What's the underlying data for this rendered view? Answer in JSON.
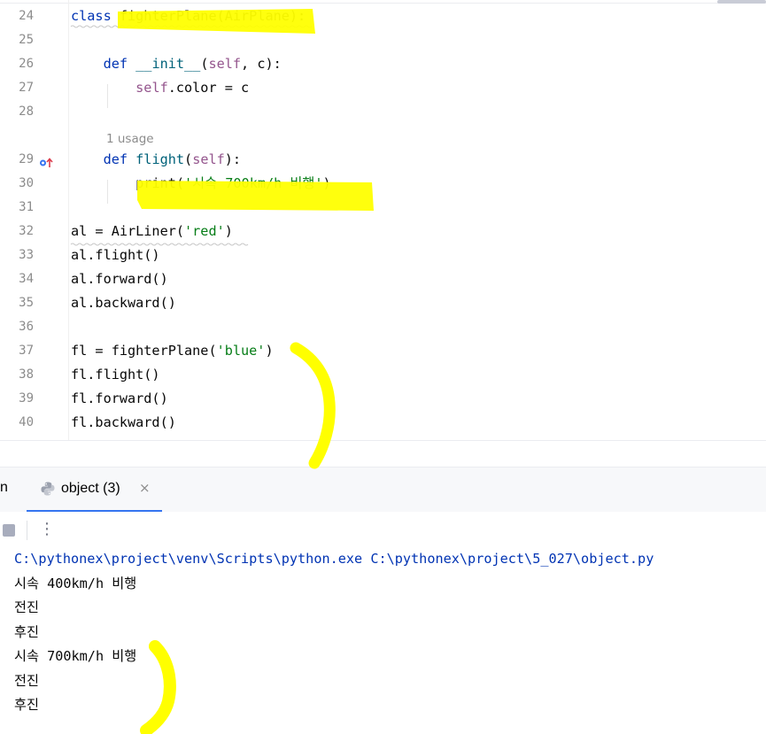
{
  "editor": {
    "inlay_hint": "1 usage",
    "lines": [
      {
        "no": "24",
        "tokens": [
          {
            "t": "class ",
            "c": "kw"
          },
          {
            "t": "fighterPlane",
            "c": ""
          },
          {
            "t": "(AirPlane):",
            "c": ""
          }
        ]
      },
      {
        "no": "25",
        "tokens": []
      },
      {
        "no": "26",
        "tokens": [
          {
            "t": "    ",
            "c": ""
          },
          {
            "t": "def ",
            "c": "kw"
          },
          {
            "t": "__init__",
            "c": "fn"
          },
          {
            "t": "(",
            "c": ""
          },
          {
            "t": "self",
            "c": "slf"
          },
          {
            "t": ", c):",
            "c": ""
          }
        ]
      },
      {
        "no": "27",
        "tokens": [
          {
            "t": "        ",
            "c": ""
          },
          {
            "t": "self",
            "c": "slf"
          },
          {
            "t": ".color = c",
            "c": ""
          }
        ]
      },
      {
        "no": "28",
        "tokens": []
      },
      {
        "no": "29",
        "tokens": [
          {
            "t": "    ",
            "c": ""
          },
          {
            "t": "def ",
            "c": "kw"
          },
          {
            "t": "flight",
            "c": "fn"
          },
          {
            "t": "(",
            "c": ""
          },
          {
            "t": "self",
            "c": "slf"
          },
          {
            "t": "):",
            "c": ""
          }
        ]
      },
      {
        "no": "30",
        "tokens": [
          {
            "t": "        ",
            "c": ""
          },
          {
            "t": "print",
            "c": ""
          },
          {
            "t": "(",
            "c": ""
          },
          {
            "t": "'시속 700km/h 비행'",
            "c": "str"
          },
          {
            "t": ")",
            "c": ""
          }
        ]
      },
      {
        "no": "31",
        "tokens": []
      },
      {
        "no": "32",
        "tokens": [
          {
            "t": "al = AirLiner(",
            "c": ""
          },
          {
            "t": "'red'",
            "c": "str"
          },
          {
            "t": ")",
            "c": ""
          }
        ]
      },
      {
        "no": "33",
        "tokens": [
          {
            "t": "al.flight()",
            "c": ""
          }
        ]
      },
      {
        "no": "34",
        "tokens": [
          {
            "t": "al.forward()",
            "c": ""
          }
        ]
      },
      {
        "no": "35",
        "tokens": [
          {
            "t": "al.backward()",
            "c": ""
          }
        ]
      },
      {
        "no": "36",
        "tokens": []
      },
      {
        "no": "37",
        "tokens": [
          {
            "t": "fl = fighterPlane(",
            "c": ""
          },
          {
            "t": "'blue'",
            "c": "str"
          },
          {
            "t": ")",
            "c": ""
          }
        ]
      },
      {
        "no": "38",
        "tokens": [
          {
            "t": "fl.flight()",
            "c": ""
          }
        ]
      },
      {
        "no": "39",
        "tokens": [
          {
            "t": "fl.forward()",
            "c": ""
          }
        ]
      },
      {
        "no": "40",
        "tokens": [
          {
            "t": "fl.backward()",
            "c": ""
          }
        ]
      }
    ],
    "gutter_icons": [
      "implements-override-icon"
    ]
  },
  "run_panel": {
    "left_tab_fragment": "n",
    "tab": {
      "icon": "python-icon",
      "label": "object (3)",
      "close": "×"
    },
    "toolbar": {
      "stop_icon": "stop-icon",
      "more_label": "⋮"
    },
    "output": [
      {
        "text": "C:\\pythonex\\project\\venv\\Scripts\\python.exe C:\\pythonex\\project\\5_027\\object.py",
        "kind": "cmd"
      },
      {
        "text": "시속 400km/h 비행",
        "kind": "out"
      },
      {
        "text": "전진",
        "kind": "out"
      },
      {
        "text": "후진",
        "kind": "out"
      },
      {
        "text": "시속 700km/h 비행",
        "kind": "out"
      },
      {
        "text": "전진",
        "kind": "out"
      },
      {
        "text": "후진",
        "kind": "out"
      }
    ]
  },
  "colors": {
    "highlight": "#ffff00",
    "accent": "#3574f0",
    "keyword": "#0033b3",
    "string": "#067d17",
    "self": "#94558d",
    "function": "#00627a"
  }
}
